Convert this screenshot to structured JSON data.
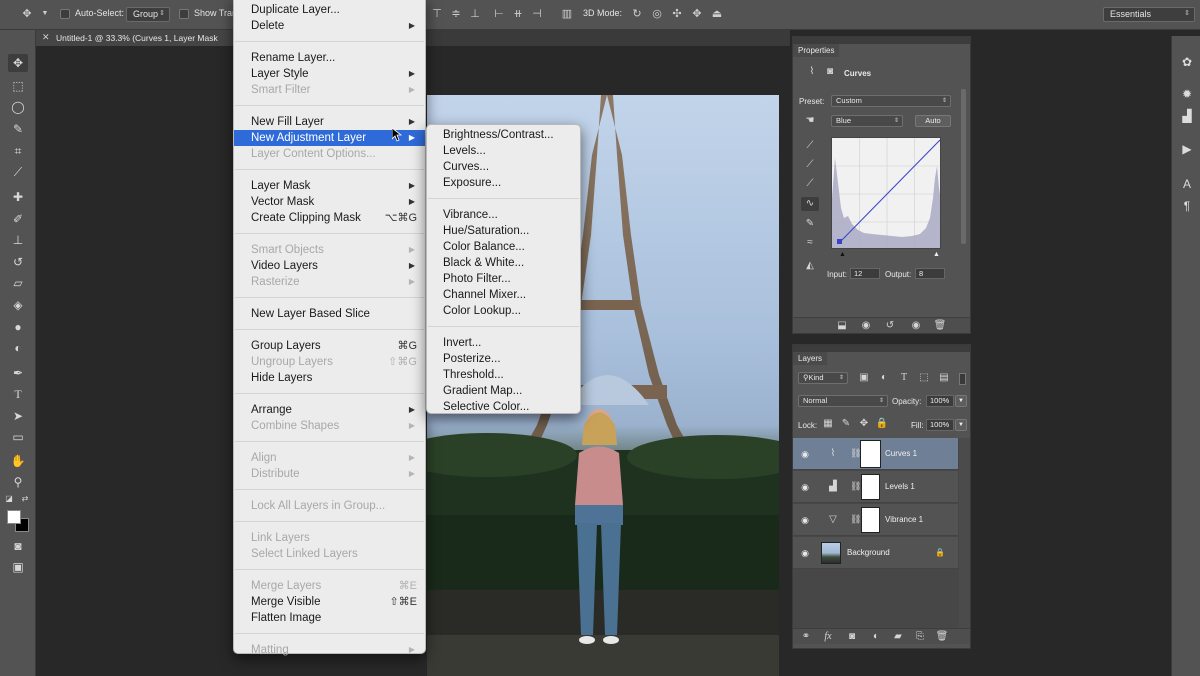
{
  "options_bar": {
    "auto_select_label": "Auto-Select:",
    "group_value": "Group",
    "show_transform_label": "Show Tran",
    "mode_3d_label": "3D Mode:",
    "workspace_value": "Essentials"
  },
  "document": {
    "tab_title": "Untitled-1 @ 33.3% (Curves 1, Layer Mask"
  },
  "main_menu": [
    {
      "label": "Duplicate Layer...",
      "top": 0
    },
    {
      "label": "Delete",
      "sub": true
    },
    {
      "sep": true
    },
    {
      "label": "Rename Layer..."
    },
    {
      "label": "Layer Style",
      "sub": true
    },
    {
      "label": "Smart Filter",
      "sub": true,
      "disabled": true
    },
    {
      "sep": true
    },
    {
      "label": "New Fill Layer",
      "sub": true
    },
    {
      "label": "New Adjustment Layer",
      "sub": true,
      "selected": true
    },
    {
      "label": "Layer Content Options...",
      "disabled": true
    },
    {
      "sep": true
    },
    {
      "label": "Layer Mask",
      "sub": true
    },
    {
      "label": "Vector Mask",
      "sub": true
    },
    {
      "label": "Create Clipping Mask",
      "shortcut": "⌥⌘G"
    },
    {
      "sep": true
    },
    {
      "label": "Smart Objects",
      "sub": true,
      "disabled": true
    },
    {
      "label": "Video Layers",
      "sub": true
    },
    {
      "label": "Rasterize",
      "sub": true,
      "disabled": true
    },
    {
      "sep": true
    },
    {
      "label": "New Layer Based Slice"
    },
    {
      "sep": true
    },
    {
      "label": "Group Layers",
      "shortcut": "⌘G"
    },
    {
      "label": "Ungroup Layers",
      "shortcut": "⇧⌘G",
      "disabled": true
    },
    {
      "label": "Hide Layers"
    },
    {
      "sep": true
    },
    {
      "label": "Arrange",
      "sub": true
    },
    {
      "label": "Combine Shapes",
      "sub": true,
      "disabled": true
    },
    {
      "sep": true
    },
    {
      "label": "Align",
      "sub": true,
      "disabled": true
    },
    {
      "label": "Distribute",
      "sub": true,
      "disabled": true
    },
    {
      "sep": true
    },
    {
      "label": "Lock All Layers in Group...",
      "disabled": true
    },
    {
      "sep": true
    },
    {
      "label": "Link Layers",
      "disabled": true
    },
    {
      "label": "Select Linked Layers",
      "disabled": true
    },
    {
      "sep": true
    },
    {
      "label": "Merge Layers",
      "shortcut": "⌘E",
      "disabled": true
    },
    {
      "label": "Merge Visible",
      "shortcut": "⇧⌘E"
    },
    {
      "label": "Flatten Image"
    },
    {
      "sep": true
    },
    {
      "label": "Matting",
      "sub": true,
      "disabled": true
    }
  ],
  "adjustment_submenu": [
    {
      "label": "Brightness/Contrast..."
    },
    {
      "label": "Levels..."
    },
    {
      "label": "Curves..."
    },
    {
      "label": "Exposure..."
    },
    {
      "sep": true
    },
    {
      "label": "Vibrance..."
    },
    {
      "label": "Hue/Saturation..."
    },
    {
      "label": "Color Balance..."
    },
    {
      "label": "Black & White..."
    },
    {
      "label": "Photo Filter..."
    },
    {
      "label": "Channel Mixer..."
    },
    {
      "label": "Color Lookup..."
    },
    {
      "sep": true
    },
    {
      "label": "Invert..."
    },
    {
      "label": "Posterize..."
    },
    {
      "label": "Threshold..."
    },
    {
      "label": "Gradient Map..."
    },
    {
      "label": "Selective Color..."
    }
  ],
  "properties": {
    "tab_label": "Properties",
    "adjustment_name": "Curves",
    "preset_label": "Preset:",
    "preset_value": "Custom",
    "channel_value": "Blue",
    "auto_label": "Auto",
    "input_label": "Input:",
    "input_value": "12",
    "output_label": "Output:",
    "output_value": "8"
  },
  "layers": {
    "tab_label": "Layers",
    "filter_value": "Kind",
    "blend_mode": "Normal",
    "opacity_label": "Opacity:",
    "opacity_value": "100%",
    "lock_label": "Lock:",
    "fill_label": "Fill:",
    "fill_value": "100%",
    "items": [
      {
        "name": "Curves 1",
        "icon": "curves-icon",
        "selected": true
      },
      {
        "name": "Levels 1",
        "icon": "levels-icon"
      },
      {
        "name": "Vibrance 1",
        "icon": "vibrance-icon"
      },
      {
        "name": "Background",
        "icon": "photo-thumbnail",
        "locked": true
      }
    ]
  },
  "colors": {
    "menu_highlight": "#2f6bd8",
    "layer_selected": "#6f7f96",
    "panel_bg": "#535353",
    "curve_line": "#3a43c8"
  }
}
